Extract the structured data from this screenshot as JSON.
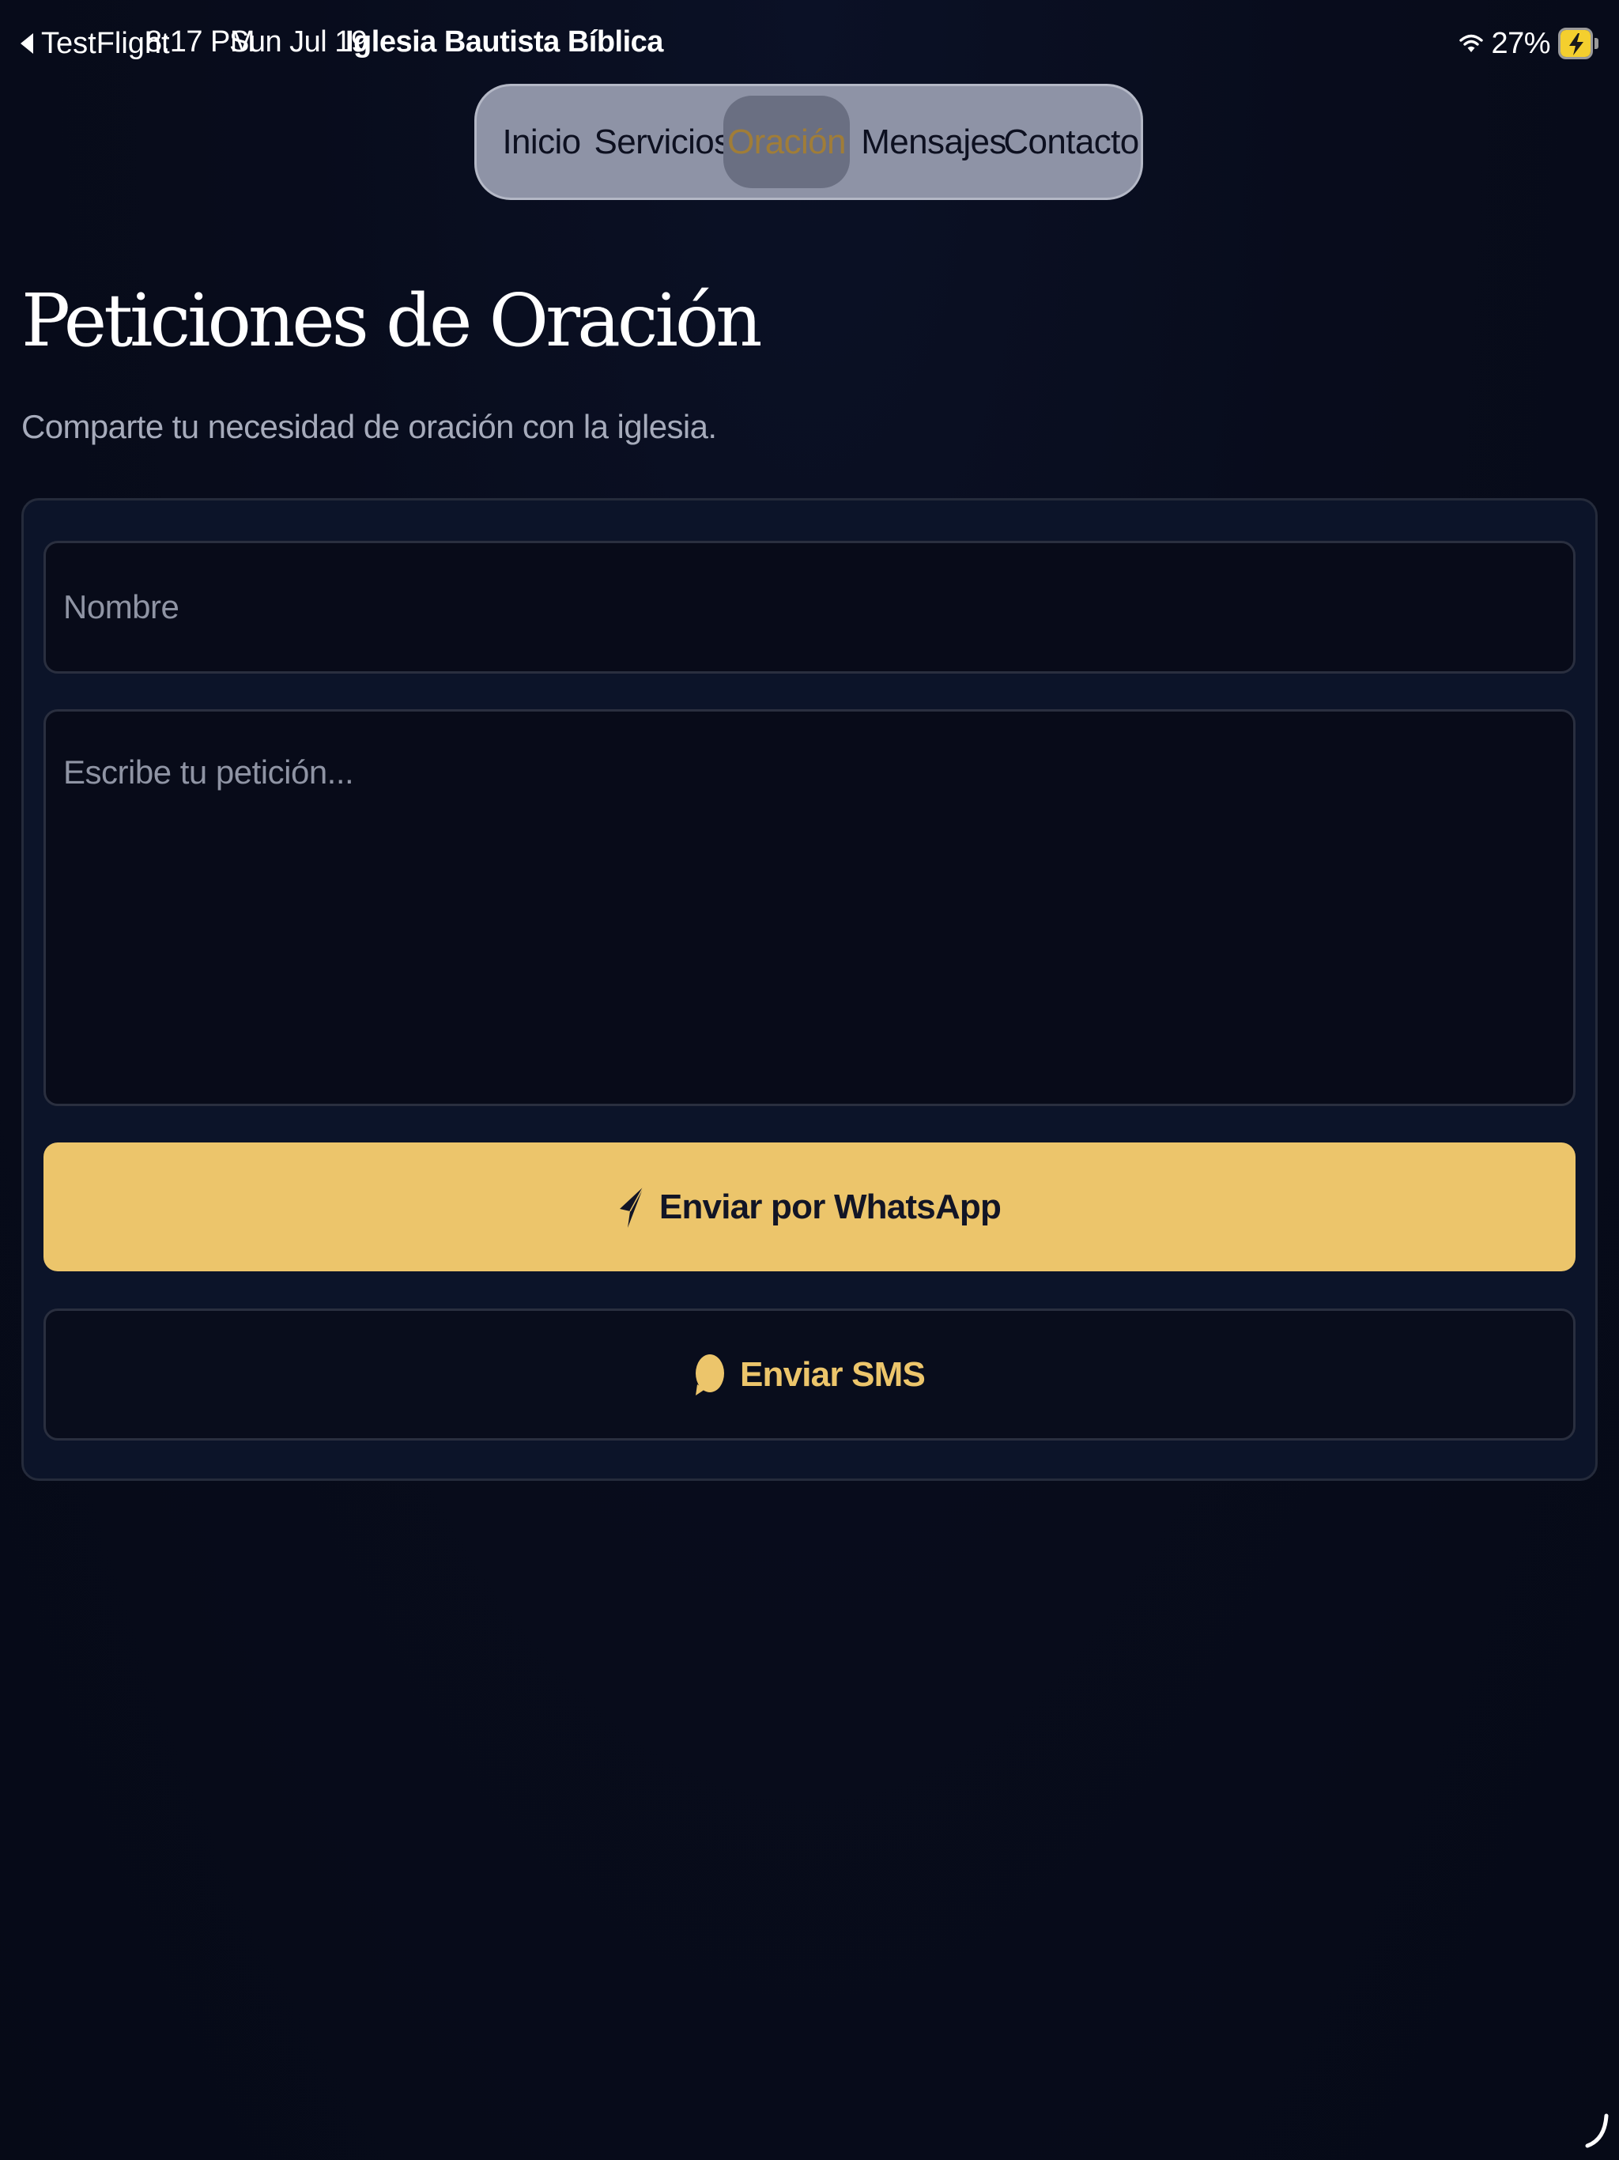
{
  "status_bar": {
    "back_label": "TestFlight",
    "time": "8:17 PM",
    "date": "Sun Jul 19",
    "app_name": "Iglesia Bautista Bíblica",
    "battery_percent_label": "27%",
    "battery_charging": true,
    "icons": [
      "back-arrow-icon",
      "wifi-icon",
      "battery-charging-icon"
    ]
  },
  "nav": {
    "items": [
      {
        "label": "Inicio",
        "active": false
      },
      {
        "label": "Servicios",
        "active": false
      },
      {
        "label": "Oración",
        "active": true
      },
      {
        "label": "Mensajes",
        "active": false
      },
      {
        "label": "Contacto",
        "active": false
      }
    ]
  },
  "page": {
    "title": "Peticiones de Oración",
    "subtitle": "Comparte tu necesidad de oración con la iglesia."
  },
  "form": {
    "name_placeholder": "Nombre",
    "name_value": "",
    "request_placeholder": "Escribe tu petición...",
    "request_value": "",
    "whatsapp_button_label": "Enviar por WhatsApp",
    "whatsapp_icon": "send-icon",
    "sms_button_label": "Enviar SMS",
    "sms_icon": "chat-bubble-icon"
  },
  "colors": {
    "background": "#080c1c",
    "card": "#0c1429",
    "accent_gold": "#ecc56b",
    "nav_pill": "#8e93a6",
    "nav_active_text": "#a07d38"
  }
}
